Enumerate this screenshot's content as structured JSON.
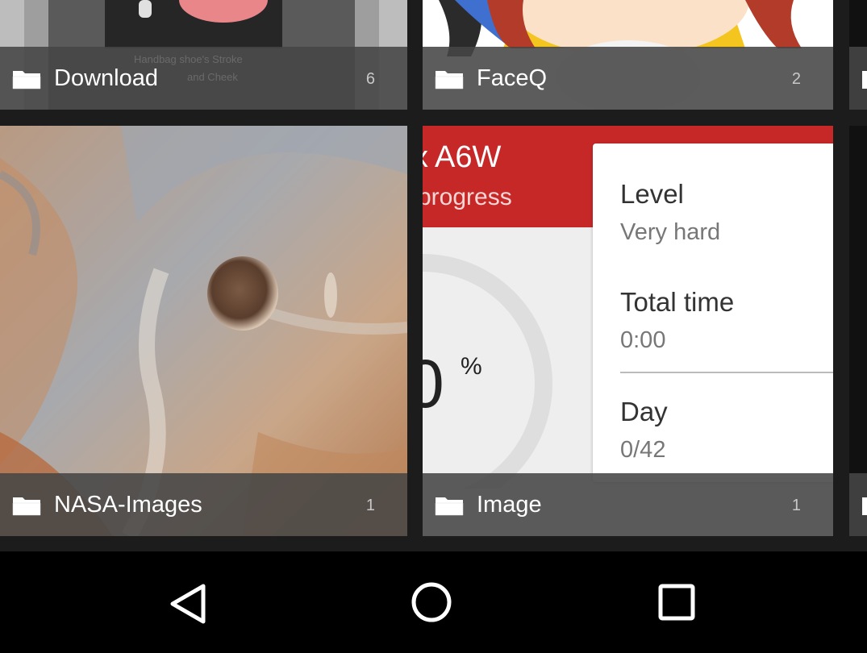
{
  "albums": [
    {
      "name": "Download",
      "count": "6"
    },
    {
      "name": "FaceQ",
      "count": "2"
    },
    {
      "name": "NASA-Images",
      "count": "1"
    },
    {
      "name": "Image",
      "count": "1"
    }
  ],
  "thumb_download": {
    "overlay_line1": "Handbag shoe's Stroke",
    "overlay_line2": "and Cheek"
  },
  "thumb_image": {
    "header_title": "A6W",
    "header_sub": "progress",
    "percent_digit": "0",
    "percent_sign": "%",
    "level_label": "Level",
    "level_value": "Very hard",
    "total_time_label": "Total time",
    "total_time_value": "0:00",
    "day_label": "Day",
    "day_value": "0/42",
    "accent_color": "#c62828"
  },
  "navigation": {
    "back": "back-icon",
    "home": "home-icon",
    "recents": "recents-icon"
  }
}
